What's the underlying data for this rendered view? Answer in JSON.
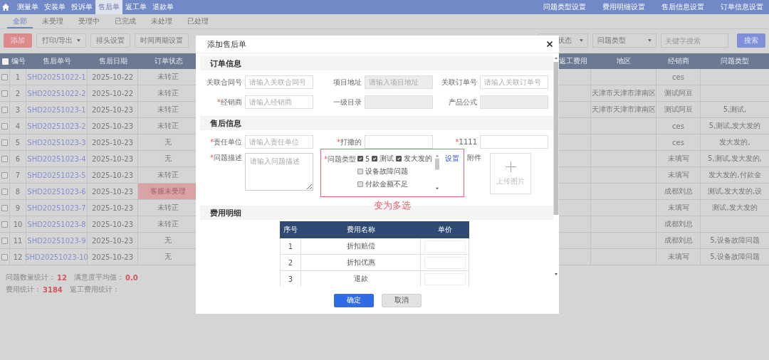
{
  "nav": {
    "items": [
      {
        "label": "测量单",
        "selected": false
      },
      {
        "label": "安装单",
        "selected": false
      },
      {
        "label": "投诉单",
        "selected": false
      },
      {
        "label": "售后单",
        "selected": true
      },
      {
        "label": "返工单",
        "selected": false
      },
      {
        "label": "退款单",
        "selected": false
      }
    ],
    "links": [
      "问题类型设置",
      "费用明细设置",
      "售后信息设置",
      "订单信息设置"
    ]
  },
  "tabs": [
    {
      "label": "全部",
      "selected": true
    },
    {
      "label": "未受理",
      "selected": false
    },
    {
      "label": "受理中",
      "selected": false
    },
    {
      "label": "已完成",
      "selected": false
    },
    {
      "label": "未处理",
      "selected": false
    },
    {
      "label": "已处理",
      "selected": false
    }
  ],
  "toolbar": {
    "add": "添加",
    "export": "打印/导出",
    "header_settings": "排头设置",
    "period_settings": "时间周期设置",
    "status_select": "状态",
    "type_select": "问题类型",
    "search": {
      "placeholder": "关键字搜索"
    },
    "search_button": "搜索"
  },
  "table": {
    "select_all_checked": false,
    "columns": [
      "编号",
      "售后单号",
      "售后日期",
      "订单状态",
      "返工费用",
      "地区",
      "经销商",
      "问题类型"
    ],
    "rows": [
      {
        "num": "1",
        "order_no": "SHD20251022-1",
        "date": "2025-10-22",
        "status": "未转正",
        "alert": false,
        "checked": false,
        "dealer": "ces"
      },
      {
        "num": "2",
        "order_no": "SHD20251022-2",
        "date": "2025-10-22",
        "status": "未转正",
        "alert": false,
        "checked": false,
        "region": "天津市天津市津南区",
        "dealer": "测试阿豆"
      },
      {
        "num": "3",
        "order_no": "SHD20251023-1",
        "date": "2025-10-23",
        "status": "未转正",
        "alert": false,
        "checked": false,
        "region": "天津市天津市津南区",
        "dealer": "测试阿豆",
        "issue_type": "5,测试,"
      },
      {
        "num": "4",
        "order_no": "SHD20251023-2",
        "date": "2025-10-23",
        "status": "未转正",
        "alert": false,
        "checked": false,
        "dealer": "ces",
        "issue_type": "5,测试,发大发的"
      },
      {
        "num": "5",
        "order_no": "SHD20251023-3",
        "date": "2025-10-23",
        "status": "无",
        "alert": false,
        "checked": false,
        "dealer": "ces",
        "issue_type": "发大发的,"
      },
      {
        "num": "6",
        "order_no": "SHD20251023-4",
        "date": "2025-10-23",
        "status": "无",
        "alert": false,
        "checked": false,
        "dealer": "未填写",
        "issue_type": "5,测试,发大发的,"
      },
      {
        "num": "7",
        "order_no": "SHD20251023-5",
        "date": "2025-10-23",
        "status": "未转正",
        "alert": false,
        "checked": false,
        "dealer": "未填写",
        "issue_type": "发大发的,付款金"
      },
      {
        "num": "8",
        "order_no": "SHD20251023-6",
        "date": "2025-10-23",
        "status": "客服未受理",
        "alert": true,
        "checked": false,
        "dealer": "成都刘总",
        "issue_type": "测试,发大发的,设"
      },
      {
        "num": "9",
        "order_no": "SHD20251023-7",
        "date": "2025-10-23",
        "status": "未转正",
        "alert": false,
        "checked": false,
        "dealer": "未填写",
        "issue_type": "测试,发大发的"
      },
      {
        "num": "10",
        "order_no": "SHD20251023-8",
        "date": "2025-10-23",
        "status": "未转正",
        "alert": false,
        "checked": false,
        "dealer": "成都刘总"
      },
      {
        "num": "11",
        "order_no": "SHD20251023-9",
        "date": "2025-10-23",
        "status": "无",
        "alert": false,
        "checked": false,
        "dealer": "成都刘总",
        "issue_type": "5,设备故障问题"
      },
      {
        "num": "12",
        "order_no": "SHD20251023-10",
        "date": "2025-10-23",
        "status": "无",
        "alert": false,
        "checked": false,
        "dealer": "未填写",
        "issue_type": "5,设备故障问题"
      }
    ]
  },
  "stats": [
    {
      "label": "问题数量统计：",
      "value": "12"
    },
    {
      "label": "满意度平均值：",
      "value": "0.0"
    },
    {
      "label": "费用统计：",
      "value": "3184"
    },
    {
      "label": "返工费用统计："
    }
  ],
  "modal": {
    "title": "添加售后单",
    "sections": [
      {
        "title": "订单信息",
        "fields": [
          {
            "label": "关联合同号",
            "placeholder": "请输入关联合同号",
            "disabled": false
          },
          {
            "label": "项目地址",
            "placeholder": "请输入项目地址",
            "disabled": true
          },
          {
            "label": "关联订单号",
            "placeholder": "请输入关联订单号",
            "disabled": false
          },
          {
            "mark": "*",
            "label": "经销商",
            "placeholder": "请输入经销商",
            "disabled": false
          },
          {
            "label": "一级目录",
            "disabled": true
          },
          {
            "label": "产品公式",
            "disabled": true
          }
        ]
      },
      {
        "title": "售后信息",
        "fields": [
          {
            "mark": "*",
            "label": "责任单位",
            "placeholder": "请输入责任单位",
            "disabled": false
          },
          {
            "mark": "*",
            "label": "打撒的",
            "disabled": false
          },
          {
            "mark": "*",
            "label": "1111",
            "disabled": false
          }
        ]
      }
    ],
    "description": {
      "mark": "*",
      "label": "问题描述",
      "placeholder": "请输入问题描述"
    },
    "issue_type": {
      "mark": "*",
      "label": "问题类型",
      "settings_link": "设置",
      "annotation": "变为多选",
      "options": [
        {
          "label": "5",
          "checked": true
        },
        {
          "label": "测试",
          "checked": true
        },
        {
          "label": "发大发的",
          "checked": true
        },
        {
          "label": "设备故障问题",
          "checked": false
        },
        {
          "label": "付款金额不足",
          "checked": false
        }
      ]
    },
    "attachment": {
      "label": "附件",
      "upload": "上传图片"
    },
    "fees": {
      "title": "费用明细",
      "columns": [
        "序号",
        "费用名称",
        "单价"
      ],
      "rows": [
        {
          "num": "1",
          "name": "折扣赔偿"
        },
        {
          "num": "2",
          "name": "折扣优惠"
        },
        {
          "num": "3",
          "name": "退款"
        }
      ]
    },
    "buttons": {
      "ok": "确定",
      "cancel": "取消"
    }
  }
}
